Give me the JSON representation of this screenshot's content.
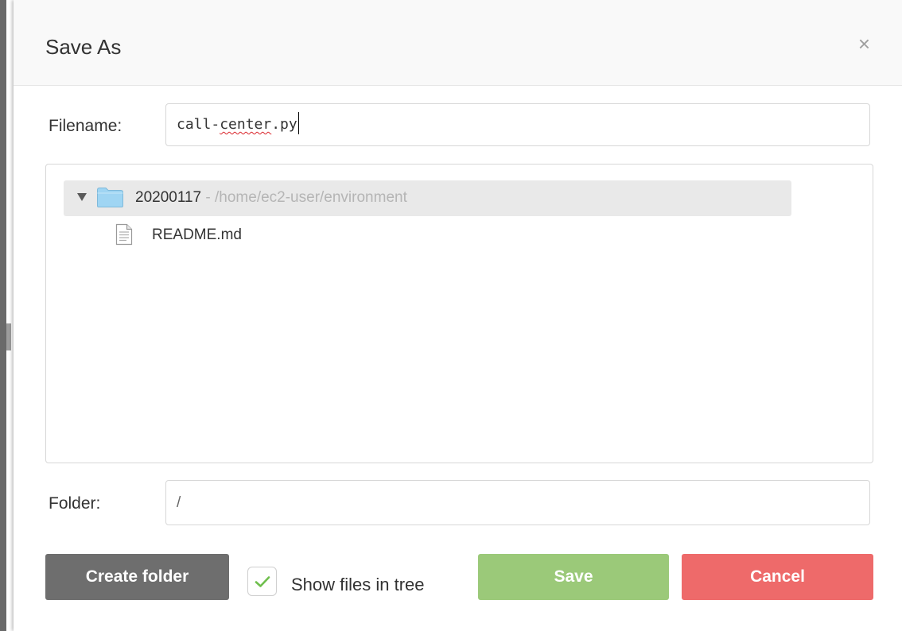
{
  "dialog": {
    "title": "Save As",
    "close_glyph": "×"
  },
  "filename": {
    "label": "Filename:",
    "prefix": "call-",
    "misspelled": "center",
    "suffix": ".py"
  },
  "tree": {
    "root": {
      "name": "20200117",
      "path": " - /home/ec2-user/environment",
      "icon": "folder-icon",
      "expanded": true
    },
    "children": [
      {
        "name": "README.md",
        "icon": "file-icon"
      }
    ]
  },
  "folder": {
    "label": "Folder:",
    "value": "/"
  },
  "footer": {
    "create_folder_label": "Create folder",
    "show_files_label": "Show files in tree",
    "show_files_checked": true,
    "save_label": "Save",
    "cancel_label": "Cancel"
  },
  "colors": {
    "save": "#9bc979",
    "cancel": "#ee6a6a",
    "create_folder": "#6e6e6e",
    "checkmark": "#6fbf4d",
    "folder_icon": "#9fd5f3"
  }
}
